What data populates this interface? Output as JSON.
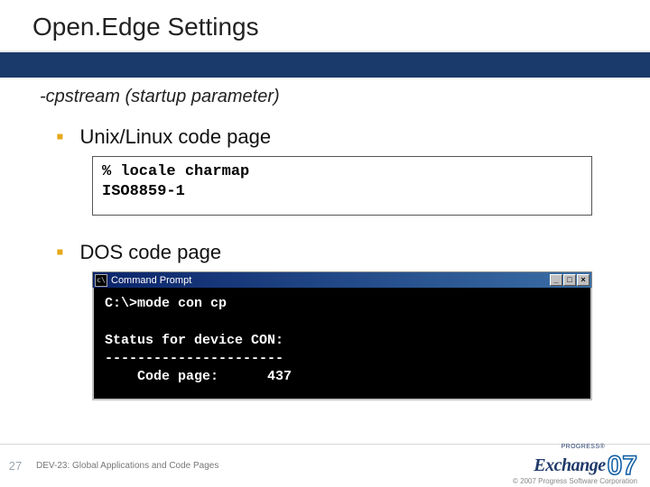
{
  "title": "Open.Edge Settings",
  "subtitle": "-cpstream (startup parameter)",
  "bullets": {
    "unix": "Unix/Linux code page",
    "dos": "DOS code page"
  },
  "unix_box": {
    "line1": "% locale charmap",
    "line2": "ISO8859-1"
  },
  "cmd_window": {
    "title": "Command Prompt",
    "min": "_",
    "max": "□",
    "close": "×",
    "body": "C:\\>mode con cp\n\nStatus for device CON:\n----------------------\n    Code page:      437"
  },
  "footer": {
    "page": "27",
    "session": "DEV-23: Global Applications and Code Pages",
    "logo_small": "PROGRESS®",
    "logo_main": "Exchange",
    "logo_year": "07",
    "copyright": "© 2007 Progress Software Corporation"
  }
}
